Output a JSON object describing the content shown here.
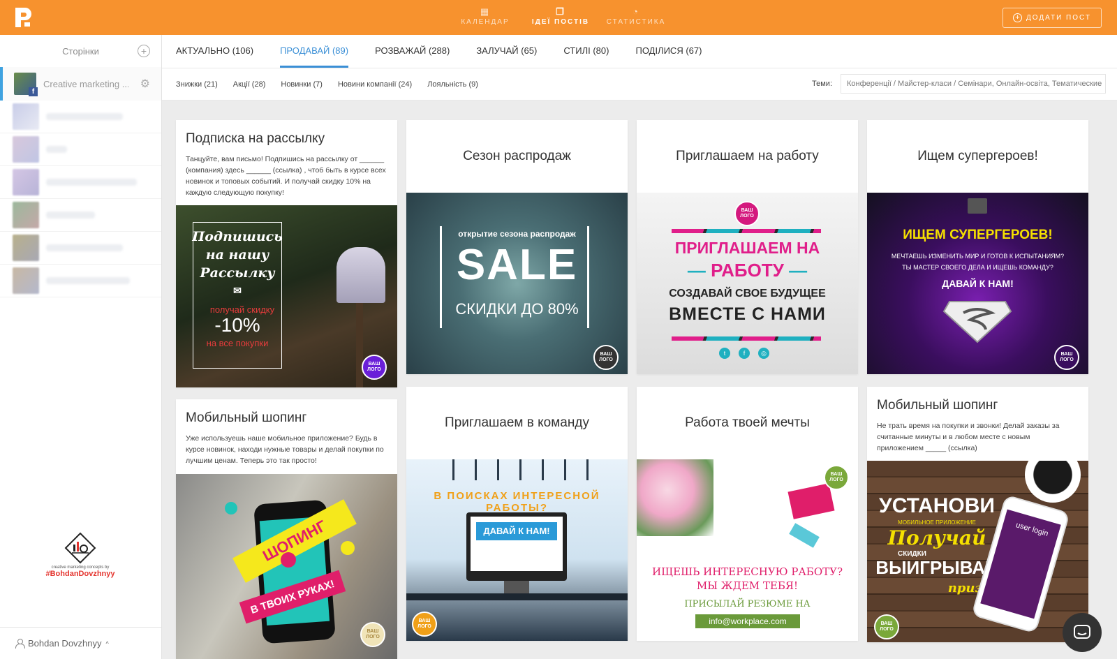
{
  "topbar": {
    "nav": [
      {
        "label": "КАЛЕНДАР",
        "icon": "calendar-icon"
      },
      {
        "label": "ІДЕЇ ПОСТІВ",
        "icon": "ideas-icon"
      },
      {
        "label": "СТАТИСТИКА",
        "icon": "chart-icon"
      }
    ],
    "add_post": "ДОДАТИ ПОСТ",
    "accent": "#f7922e"
  },
  "sidebar": {
    "title": "Сторінки",
    "active_page": "Creative marketing ...",
    "brand_small": "creative marketing concepts by",
    "brand_tag": "#BohdanDovzhnyy",
    "user": "Bohdan Dovzhnyy"
  },
  "tabs": [
    {
      "label": "АКТУАЛЬНО (106)"
    },
    {
      "label": "ПРОДАВАЙ (89)"
    },
    {
      "label": "РОЗВАЖАЙ (288)"
    },
    {
      "label": "ЗАЛУЧАЙ (65)"
    },
    {
      "label": "СТИЛІ (80)"
    },
    {
      "label": "ПОДІЛИСЯ (67)"
    }
  ],
  "subtabs": [
    {
      "label": "Знижки (21)"
    },
    {
      "label": "Акції (28)"
    },
    {
      "label": "Новинки (7)"
    },
    {
      "label": "Новини компанії (24)"
    },
    {
      "label": "Лояльність (9)"
    }
  ],
  "themes": {
    "label": "Теми:",
    "value": "Конференції / Майстер-класи / Семінари, Онлайн-освіта, Тематичеcкие"
  },
  "cards": {
    "c1": {
      "title": "Подписка на рассылку",
      "desc": "Танцуйте, вам письмо! Подпишись на рассылку от ______ (компания) здесь ______ (ссылка) , чтоб быть в курсе всех новинок и топовых событий. И получай скидку 10% на каждую следующую покупку!",
      "img_l1": "Подпишись",
      "img_l2": "на нашу",
      "img_l3": "Рассылку",
      "img_l4": "получай скидку",
      "img_l5": "-10%",
      "img_l6": "на все покупки",
      "badge": "ВАШ ЛОГО"
    },
    "c2": {
      "title": "Сезон распродаж",
      "img_l1": "открытие сезона распродаж",
      "img_l2": "SALE",
      "img_l3": "СКИДКИ ДО 80%",
      "badge": "ВАШ ЛОГО"
    },
    "c3": {
      "title": "Приглашаем на работу",
      "img_l1": "ПРИГЛАШАЕМ НА",
      "img_l2": "РАБОТУ",
      "img_l3": "СОЗДАВАЙ СВОЕ БУДУЩЕЕ",
      "img_l4": "ВМЕСТЕ С НАМИ",
      "badge": "ВАШ ЛОГО"
    },
    "c4": {
      "title": "Ищем супергероев!",
      "img_l1": "ИЩЕМ СУПЕРГЕРОЕВ!",
      "img_l2": "МЕЧТАЕШЬ ИЗМЕНИТЬ МИР И ГОТОВ К ИСПЫТАНИЯМ?",
      "img_l3": "ТЫ МАСТЕР СВОЕГО ДЕЛА И ИЩЕШЬ КОМАНДУ?",
      "img_l4": "ДАВАЙ К НАМ!",
      "badge": "ВАШ ЛОГО"
    },
    "c5": {
      "title": "Мобильный шопинг",
      "desc": "Уже используешь наше мобильное приложение? Будь в курсе новинок, находи нужные товары и делай покупки по лучшим ценам. Теперь это так просто!",
      "img_l1": "ШОПИНГ",
      "img_l2": "В ТВОИХ РУКАХ!",
      "badge": "ВАШ ЛОГО"
    },
    "c6": {
      "title": "Приглашаем в команду",
      "img_l1": "В ПОИСКАХ ИНТЕРЕСНОЙ РАБОТЫ?",
      "img_l2": "ДАВАЙ К НАМ!",
      "badge": "ВАШ ЛОГО"
    },
    "c7": {
      "title": "Работа твоей мечты",
      "img_l1": "ИЩЕШЬ ИНТЕРЕСНУЮ РАБОТУ?",
      "img_l2": "МЫ ЖДЕМ ТЕБЯ!",
      "img_l3": "ПРИСЫЛАЙ РЕЗЮМЕ НА",
      "img_l4": "info@workplace.com",
      "badge": "ВАШ ЛОГО"
    },
    "c8": {
      "title": "Мобильный шопинг",
      "desc": "Не трать время на покупки и звонки! Делай заказы за считанные минуты и в любом месте с новым приложением _____ (ссылка)",
      "img_l1": "УСТАНОВИ",
      "img_l2": "МОБИЛЬНОЕ ПРИЛОЖЕНИЕ",
      "img_l3": "Получай",
      "img_l4": "СКИДКИ",
      "img_l5": "ВЫИГРЫВАЙ",
      "img_l6": "призы",
      "img_l7": "user login",
      "badge": "ВАШ ЛОГО"
    }
  }
}
